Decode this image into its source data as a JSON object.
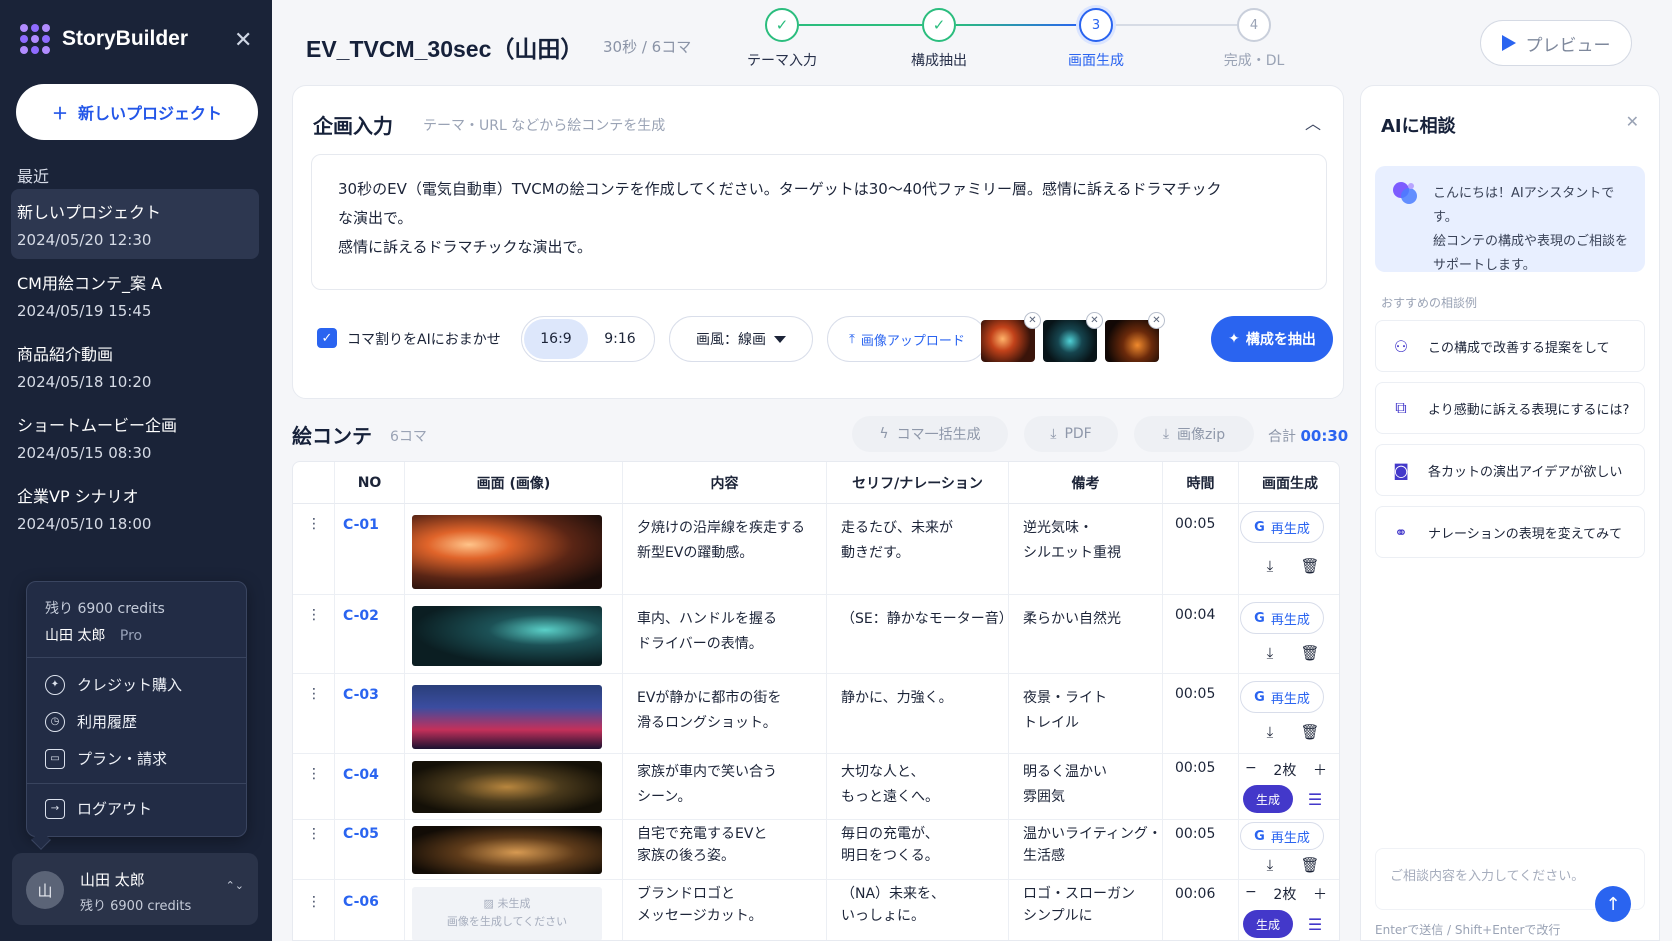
{
  "sidebar": {
    "brand": "StoryBuilder",
    "new_project_label": "新しいプロジェクト",
    "recent_label": "最近",
    "recent": [
      {
        "title": "新しいプロジェクト",
        "date": "2024/05/20 12:30",
        "active": true
      },
      {
        "title": "CM用絵コンテ_案 A",
        "date": "2024/05/19 15:45"
      },
      {
        "title": "商品紹介動画",
        "date": "2024/05/18 10:20"
      },
      {
        "title": "ショートムービー企画",
        "date": "2024/05/15 08:30"
      },
      {
        "title": "企業VP シナリオ",
        "date": "2024/05/10 18:00"
      }
    ],
    "user_menu": {
      "credits": "残り 6900 credits",
      "user_name": "山田 太郎",
      "plan": "Pro",
      "items": [
        {
          "label": "クレジット購入",
          "icon": "credit-icon"
        },
        {
          "label": "利用履歴",
          "icon": "clock-icon"
        },
        {
          "label": "プラン・請求",
          "icon": "card-icon"
        }
      ],
      "logout": "ログアウト"
    },
    "user_card": {
      "avatar": "山",
      "name": "山田 太郎",
      "credits": "残り 6900 credits"
    }
  },
  "header": {
    "title": "EV_TVCM_30sec（山田）",
    "subtitle": "30秒 / 6コマ",
    "steps": [
      {
        "num": "✓",
        "label": "テーマ入力",
        "state": "done"
      },
      {
        "num": "✓",
        "label": "構成抽出",
        "state": "done"
      },
      {
        "num": "3",
        "label": "画面生成",
        "state": "current"
      },
      {
        "num": "4",
        "label": "完成・DL",
        "state": "future"
      }
    ],
    "preview_label": "プレビュー"
  },
  "planning": {
    "title": "企画入力",
    "subtitle": "テーマ・URL などから絵コンテを生成",
    "prompt": "30秒のEV（電気自動車）TVCMの絵コンテを作成してください。ターゲットは30〜40代ファミリー層。感情に訴えるドラマチック\nな演出で。\n感情に訴えるドラマチックな演出で。",
    "auto_split_label": "コマ割りをAIにおまかせ",
    "ratios": [
      "16:9",
      "9:16"
    ],
    "active_ratio": "16:9",
    "style_label": "画風：線画",
    "upload_label": "画像アップロード",
    "extract_label": "構成を抽出"
  },
  "storyboard": {
    "title": "絵コンテ",
    "count": "6コマ",
    "bulk_label": "コマ一括生成",
    "pdf_label": "PDF",
    "zip_label": "画像zip",
    "total_label": "合計",
    "total_value": "00:30",
    "columns": [
      "NO",
      "画面 (画像)",
      "内容",
      "セリフ/ナレーション",
      "備考",
      "時間",
      "画面生成"
    ],
    "regen_label": "再生成",
    "gen_label": "生成",
    "count_suffix": "2枚",
    "empty_title": "未生成",
    "empty_hint": "画像を生成してください",
    "rows": [
      {
        "id": "C-01",
        "content": "夕焼けの沿岸線を疾走する\n新型EVの躍動感。",
        "line": "走るたび、未来が\n動きだす。",
        "note": "逆光気味・\nシルエット重視",
        "time": "00:05",
        "mode": "regen"
      },
      {
        "id": "C-02",
        "content": "車内、ハンドルを握る\nドライバーの表情。",
        "line": "（SE：静かなモーター音）",
        "note": "柔らかい自然光",
        "time": "00:04",
        "mode": "regen"
      },
      {
        "id": "C-03",
        "content": "EVが静かに都市の街を\n滑るロングショット。",
        "line": "静かに、力強く。",
        "note": "夜景・ライト\nトレイル",
        "time": "00:05",
        "mode": "regen"
      },
      {
        "id": "C-04",
        "content": "家族が車内で笑い合う\nシーン。",
        "line": "大切な人と、\nもっと遠くへ。",
        "note": "明るく温かい\n雰囲気",
        "time": "00:05",
        "mode": "gen"
      },
      {
        "id": "C-05",
        "content": "自宅で充電するEVと\n家族の後ろ姿。",
        "line": "毎日の充電が、\n明日をつくる。",
        "note": "温かいライティング・\n生活感",
        "time": "00:05",
        "mode": "regen"
      },
      {
        "id": "C-06",
        "content": "ブランドロゴと\nメッセージカット。",
        "line": "（NA）未来を、\nいっしょに。",
        "note": "ロゴ・スローガン\nシンプルに",
        "time": "00:06",
        "mode": "gen"
      }
    ]
  },
  "ai": {
    "title": "AIに相談",
    "greeting": "こんにちは！AIアシスタントです。\n絵コンテの構成や表現のご相談を\nサポートします。",
    "suggest_label": "おすすめの相談例",
    "suggestions": [
      {
        "label": "この構成で改善する提案をして",
        "icon": "nodes-icon"
      },
      {
        "label": "より感動に訴える表現にするには?",
        "icon": "image-edit-icon"
      },
      {
        "label": "各カットの演出アイデアが欲しい",
        "icon": "camera-icon"
      },
      {
        "label": "ナレーションの表現を変えてみて",
        "icon": "link-icon"
      }
    ],
    "input_placeholder": "ご相談内容を入力してください。",
    "hint": "Enterで送信 / Shift+Enterで改行"
  },
  "colors": {
    "accent": "#2a64f0",
    "sidebar": "#1a2338",
    "done": "#2bbd7e",
    "gen": "#4338ca"
  }
}
